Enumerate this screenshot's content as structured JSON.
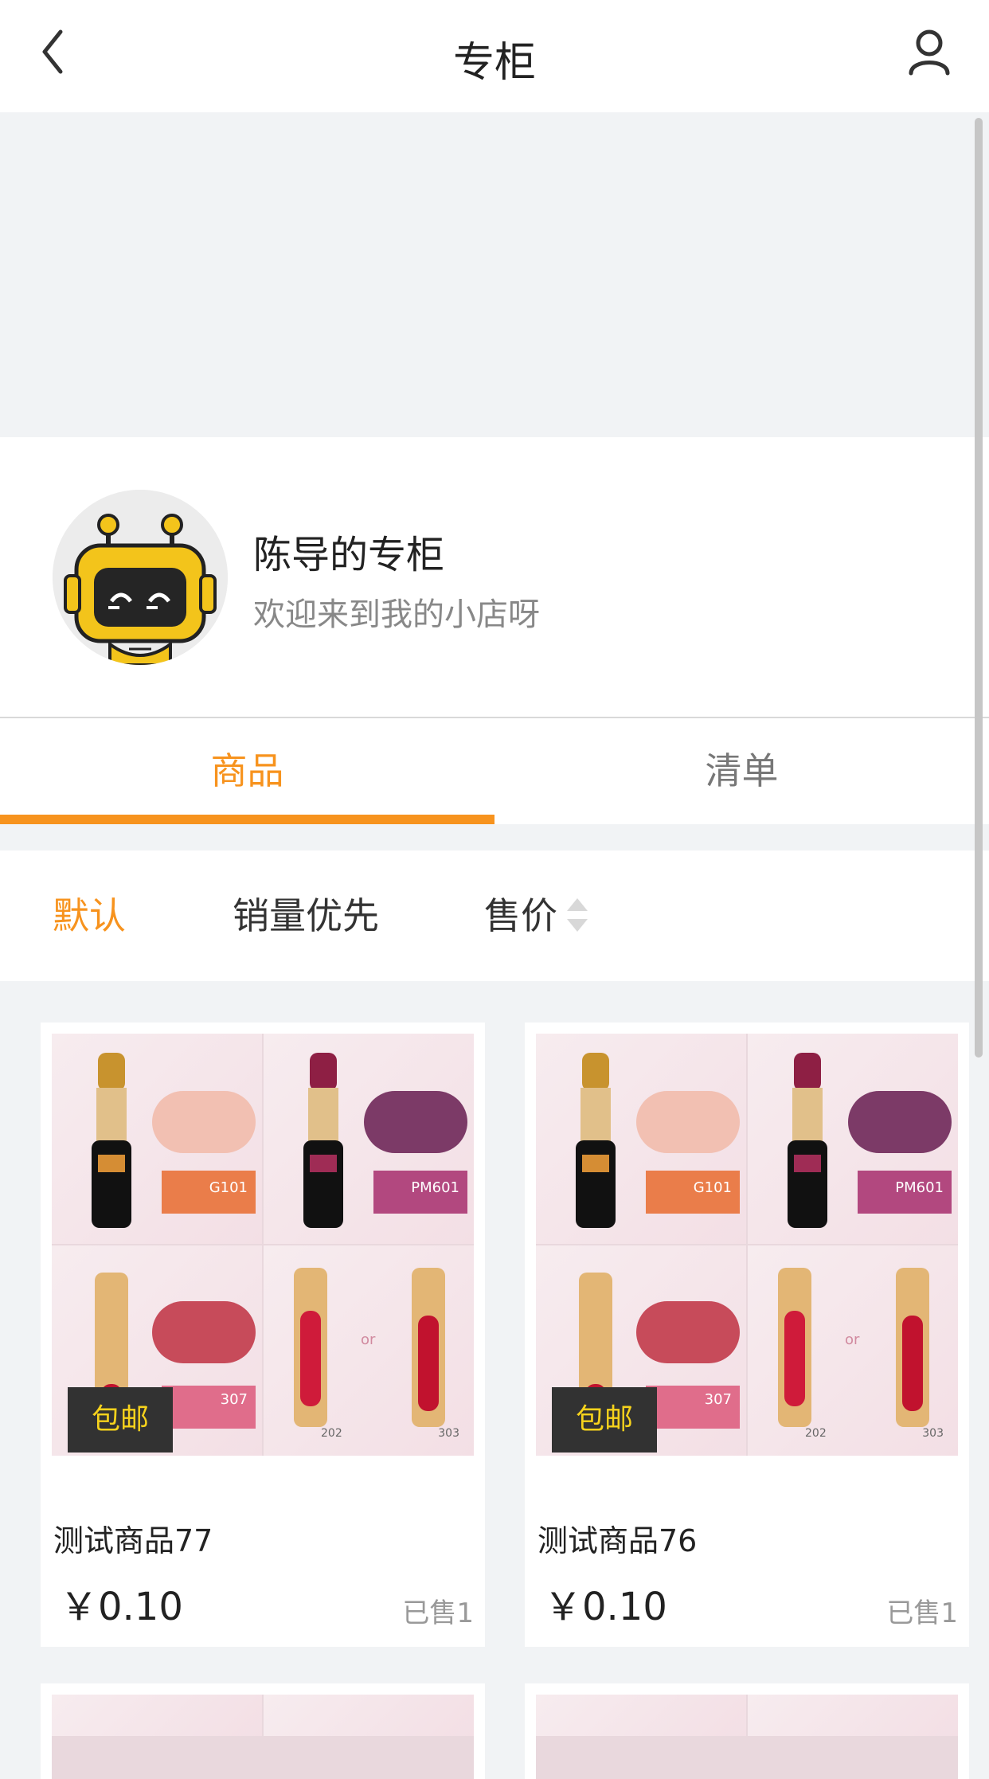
{
  "header": {
    "title": "专柜"
  },
  "shop": {
    "name": "陈导的专柜",
    "desc": "欢迎来到我的小店呀"
  },
  "tabs": {
    "active_label": "商品",
    "inactive_label": "清单"
  },
  "sort": {
    "s1": "默认",
    "s2": "销量优先",
    "s3": "售价"
  },
  "products": [
    {
      "badge": "包邮",
      "name": "测试商品77",
      "price": "￥0.10",
      "sold": "已售1",
      "labels": {
        "tile1": "G101",
        "tile2": "PM601",
        "tile3": "307",
        "tile4_or": "or",
        "tile4_n1": "202",
        "tile4_n2": "303"
      }
    },
    {
      "badge": "包邮",
      "name": "测试商品76",
      "price": "￥0.10",
      "sold": "已售1",
      "labels": {
        "tile1": "G101",
        "tile2": "PM601",
        "tile3": "307",
        "tile4_or": "or",
        "tile4_n1": "202",
        "tile4_n2": "303"
      }
    }
  ],
  "colors": {
    "accent": "#f7931e",
    "bg": "#f1f3f5",
    "badge_bg": "#323232",
    "badge_text": "#f6d21c"
  },
  "icons": {
    "back": "chevron-left-icon",
    "user": "user-icon",
    "sort_arrows": "sort-arrows-icon"
  }
}
